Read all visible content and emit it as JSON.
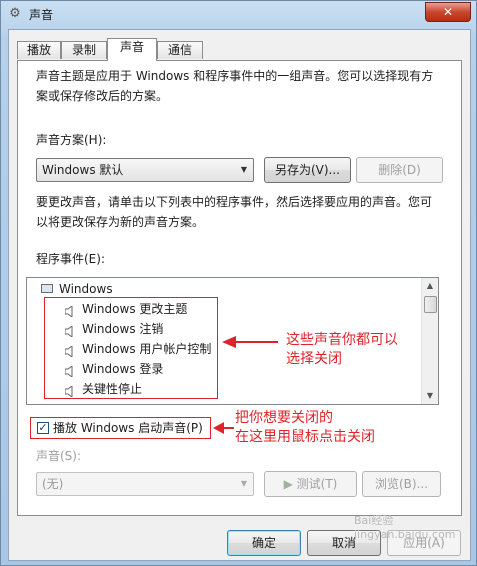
{
  "window": {
    "title": "声音",
    "close_symbol": "✕",
    "icon": "speaker-icon"
  },
  "tabs": [
    {
      "label": "播放"
    },
    {
      "label": "录制"
    },
    {
      "label": "声音",
      "active": true
    },
    {
      "label": "通信"
    }
  ],
  "intro_line1": "声音主题是应用于 Windows 和程序事件中的一组声音。您可以选择现有方",
  "intro_line2": "案或保存修改后的方案。",
  "scheme": {
    "label": "声音方案(H):",
    "value": "Windows 默认",
    "save_as_label": "另存为(V)...",
    "delete_label": "删除(D)"
  },
  "change_line1": "要更改声音，请单击以下列表中的程序事件，然后选择要应用的声音。您可",
  "change_line2": "以将更改保存为新的声音方案。",
  "events": {
    "label": "程序事件(E):",
    "group": "Windows",
    "items": [
      {
        "label": "Windows 更改主题"
      },
      {
        "label": "Windows 注销"
      },
      {
        "label": "Windows 用户帐户控制"
      },
      {
        "label": "Windows 登录"
      },
      {
        "label": "关键性停止"
      }
    ]
  },
  "startup_checkbox": {
    "label": "播放 Windows 启动声音(P)",
    "checked": true
  },
  "sound": {
    "label": "声音(S):",
    "value": "(无)",
    "test_label": "测试(T)",
    "browse_label": "浏览(B)..."
  },
  "annotations": {
    "list_note_line1": "这些声音你都可以",
    "list_note_line2": "选择关闭",
    "checkbox_note_line1": "把你想要关闭的",
    "checkbox_note_line2": "在这里用鼠标点击关闭"
  },
  "footer": {
    "ok_label": "确定",
    "cancel_label": "取消",
    "apply_label": "应用(A)"
  },
  "watermark": "Bai经验 jingyan.baidu.com",
  "colors": {
    "annotation_red": "#e0232a",
    "titlebar_blue": "#b6d0ea",
    "close_red": "#c8482e"
  }
}
